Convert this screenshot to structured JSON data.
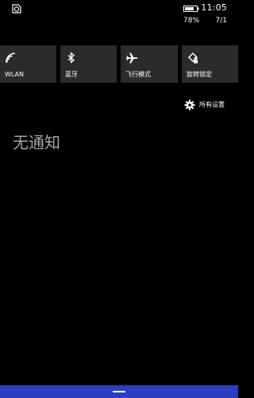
{
  "status_bar": {
    "time": "11:05",
    "battery_percent": "78%",
    "battery_level": 0.78,
    "date": "7/1",
    "sync_icon": "sync-icon",
    "battery_icon": "battery-icon"
  },
  "quick_actions": [
    {
      "label": "WLAN",
      "icon": "wifi-icon"
    },
    {
      "label": "蓝牙",
      "icon": "bluetooth-icon"
    },
    {
      "label": "飞行模式",
      "icon": "airplane-icon"
    },
    {
      "label": "旋转锁定",
      "icon": "rotation-lock-icon"
    }
  ],
  "all_settings": {
    "label": "所有设置",
    "icon": "gear-icon"
  },
  "notifications": {
    "empty_text": "无通知"
  },
  "colors": {
    "background": "#000000",
    "tile_background": "#2b2b2b",
    "empty_text": "#a6a6a6",
    "bottom_bar": "#2b3fbf"
  }
}
